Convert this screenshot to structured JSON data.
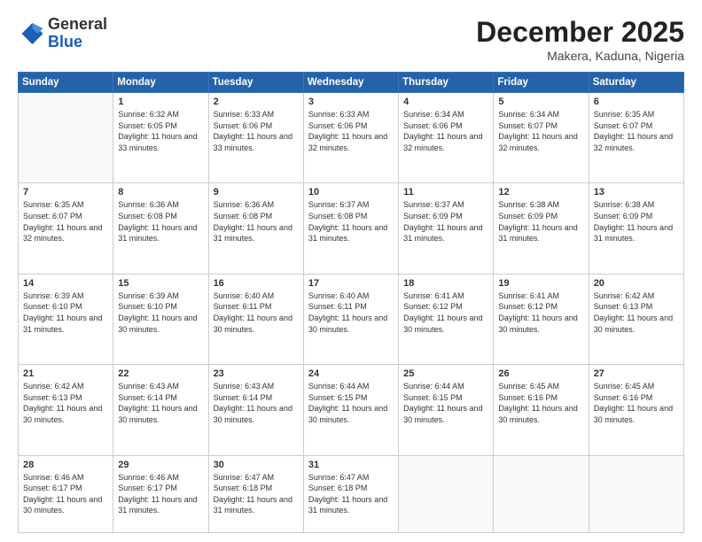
{
  "header": {
    "logo": {
      "general": "General",
      "blue": "Blue"
    },
    "title": "December 2025",
    "location": "Makera, Kaduna, Nigeria"
  },
  "calendar": {
    "days_of_week": [
      "Sunday",
      "Monday",
      "Tuesday",
      "Wednesday",
      "Thursday",
      "Friday",
      "Saturday"
    ],
    "weeks": [
      [
        {
          "day": "",
          "empty": true
        },
        {
          "day": "1",
          "sunrise": "Sunrise: 6:32 AM",
          "sunset": "Sunset: 6:05 PM",
          "daylight": "Daylight: 11 hours and 33 minutes."
        },
        {
          "day": "2",
          "sunrise": "Sunrise: 6:33 AM",
          "sunset": "Sunset: 6:06 PM",
          "daylight": "Daylight: 11 hours and 33 minutes."
        },
        {
          "day": "3",
          "sunrise": "Sunrise: 6:33 AM",
          "sunset": "Sunset: 6:06 PM",
          "daylight": "Daylight: 11 hours and 32 minutes."
        },
        {
          "day": "4",
          "sunrise": "Sunrise: 6:34 AM",
          "sunset": "Sunset: 6:06 PM",
          "daylight": "Daylight: 11 hours and 32 minutes."
        },
        {
          "day": "5",
          "sunrise": "Sunrise: 6:34 AM",
          "sunset": "Sunset: 6:07 PM",
          "daylight": "Daylight: 11 hours and 32 minutes."
        },
        {
          "day": "6",
          "sunrise": "Sunrise: 6:35 AM",
          "sunset": "Sunset: 6:07 PM",
          "daylight": "Daylight: 11 hours and 32 minutes."
        }
      ],
      [
        {
          "day": "7",
          "sunrise": "Sunrise: 6:35 AM",
          "sunset": "Sunset: 6:07 PM",
          "daylight": "Daylight: 11 hours and 32 minutes."
        },
        {
          "day": "8",
          "sunrise": "Sunrise: 6:36 AM",
          "sunset": "Sunset: 6:08 PM",
          "daylight": "Daylight: 11 hours and 31 minutes."
        },
        {
          "day": "9",
          "sunrise": "Sunrise: 6:36 AM",
          "sunset": "Sunset: 6:08 PM",
          "daylight": "Daylight: 11 hours and 31 minutes."
        },
        {
          "day": "10",
          "sunrise": "Sunrise: 6:37 AM",
          "sunset": "Sunset: 6:08 PM",
          "daylight": "Daylight: 11 hours and 31 minutes."
        },
        {
          "day": "11",
          "sunrise": "Sunrise: 6:37 AM",
          "sunset": "Sunset: 6:09 PM",
          "daylight": "Daylight: 11 hours and 31 minutes."
        },
        {
          "day": "12",
          "sunrise": "Sunrise: 6:38 AM",
          "sunset": "Sunset: 6:09 PM",
          "daylight": "Daylight: 11 hours and 31 minutes."
        },
        {
          "day": "13",
          "sunrise": "Sunrise: 6:38 AM",
          "sunset": "Sunset: 6:09 PM",
          "daylight": "Daylight: 11 hours and 31 minutes."
        }
      ],
      [
        {
          "day": "14",
          "sunrise": "Sunrise: 6:39 AM",
          "sunset": "Sunset: 6:10 PM",
          "daylight": "Daylight: 11 hours and 31 minutes."
        },
        {
          "day": "15",
          "sunrise": "Sunrise: 6:39 AM",
          "sunset": "Sunset: 6:10 PM",
          "daylight": "Daylight: 11 hours and 30 minutes."
        },
        {
          "day": "16",
          "sunrise": "Sunrise: 6:40 AM",
          "sunset": "Sunset: 6:11 PM",
          "daylight": "Daylight: 11 hours and 30 minutes."
        },
        {
          "day": "17",
          "sunrise": "Sunrise: 6:40 AM",
          "sunset": "Sunset: 6:11 PM",
          "daylight": "Daylight: 11 hours and 30 minutes."
        },
        {
          "day": "18",
          "sunrise": "Sunrise: 6:41 AM",
          "sunset": "Sunset: 6:12 PM",
          "daylight": "Daylight: 11 hours and 30 minutes."
        },
        {
          "day": "19",
          "sunrise": "Sunrise: 6:41 AM",
          "sunset": "Sunset: 6:12 PM",
          "daylight": "Daylight: 11 hours and 30 minutes."
        },
        {
          "day": "20",
          "sunrise": "Sunrise: 6:42 AM",
          "sunset": "Sunset: 6:13 PM",
          "daylight": "Daylight: 11 hours and 30 minutes."
        }
      ],
      [
        {
          "day": "21",
          "sunrise": "Sunrise: 6:42 AM",
          "sunset": "Sunset: 6:13 PM",
          "daylight": "Daylight: 11 hours and 30 minutes."
        },
        {
          "day": "22",
          "sunrise": "Sunrise: 6:43 AM",
          "sunset": "Sunset: 6:14 PM",
          "daylight": "Daylight: 11 hours and 30 minutes."
        },
        {
          "day": "23",
          "sunrise": "Sunrise: 6:43 AM",
          "sunset": "Sunset: 6:14 PM",
          "daylight": "Daylight: 11 hours and 30 minutes."
        },
        {
          "day": "24",
          "sunrise": "Sunrise: 6:44 AM",
          "sunset": "Sunset: 6:15 PM",
          "daylight": "Daylight: 11 hours and 30 minutes."
        },
        {
          "day": "25",
          "sunrise": "Sunrise: 6:44 AM",
          "sunset": "Sunset: 6:15 PM",
          "daylight": "Daylight: 11 hours and 30 minutes."
        },
        {
          "day": "26",
          "sunrise": "Sunrise: 6:45 AM",
          "sunset": "Sunset: 6:16 PM",
          "daylight": "Daylight: 11 hours and 30 minutes."
        },
        {
          "day": "27",
          "sunrise": "Sunrise: 6:45 AM",
          "sunset": "Sunset: 6:16 PM",
          "daylight": "Daylight: 11 hours and 30 minutes."
        }
      ],
      [
        {
          "day": "28",
          "sunrise": "Sunrise: 6:46 AM",
          "sunset": "Sunset: 6:17 PM",
          "daylight": "Daylight: 11 hours and 30 minutes."
        },
        {
          "day": "29",
          "sunrise": "Sunrise: 6:46 AM",
          "sunset": "Sunset: 6:17 PM",
          "daylight": "Daylight: 11 hours and 31 minutes."
        },
        {
          "day": "30",
          "sunrise": "Sunrise: 6:47 AM",
          "sunset": "Sunset: 6:18 PM",
          "daylight": "Daylight: 11 hours and 31 minutes."
        },
        {
          "day": "31",
          "sunrise": "Sunrise: 6:47 AM",
          "sunset": "Sunset: 6:18 PM",
          "daylight": "Daylight: 11 hours and 31 minutes."
        },
        {
          "day": "",
          "empty": true
        },
        {
          "day": "",
          "empty": true
        },
        {
          "day": "",
          "empty": true
        }
      ]
    ]
  }
}
